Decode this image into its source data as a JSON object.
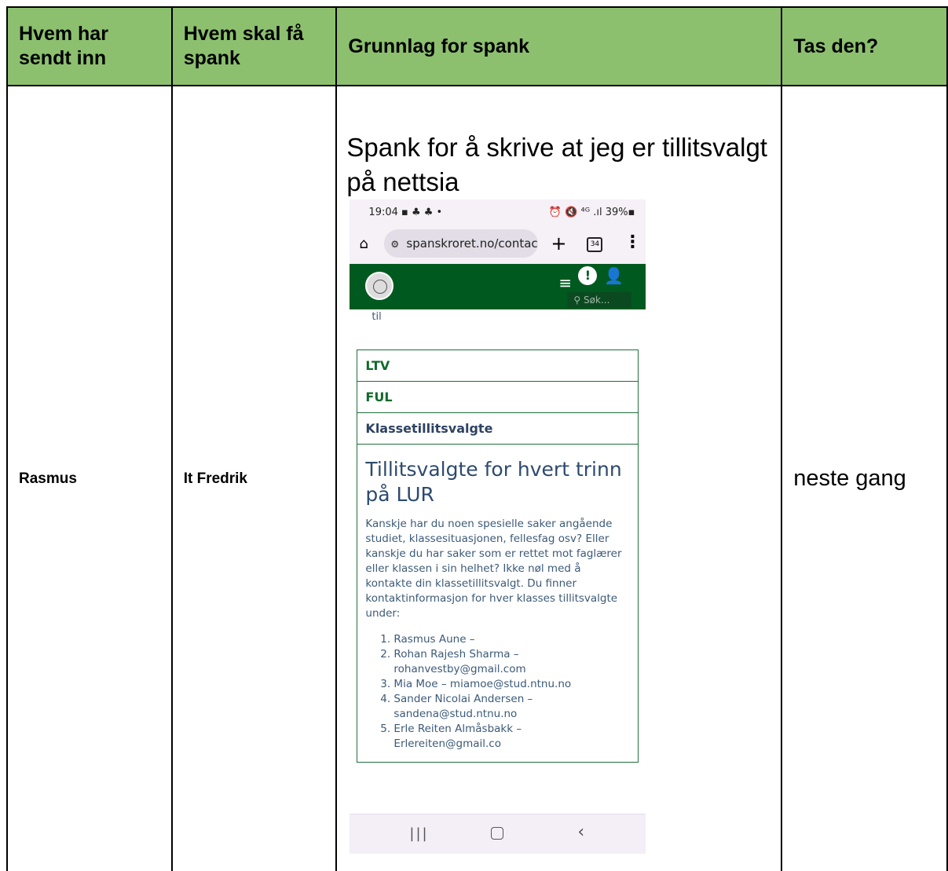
{
  "headers": {
    "col1": "Hvem har sendt inn",
    "col2": "Hvem skal få spank",
    "col3": "Grunnlag for spank",
    "col4": "Tas den?"
  },
  "row": {
    "sender": "Rasmus",
    "target": "It Fredrik",
    "reason": "Spank for å skrive at jeg er tillitsvalgt på nettsia",
    "decision": "neste gang"
  },
  "phone": {
    "status_time": "19:04 ▪ ♣ ♣ •",
    "status_right": "⏰ 🔇 ⁴ᴳ .ıl 39%▪",
    "url": "spanskroret.no/contac",
    "tab_count": "34",
    "search_placeholder": "Søk...",
    "til_text": "til",
    "menu_rows": [
      "LTV",
      "FUL",
      "Klassetillitsvalgte"
    ],
    "heading": "Tillitsvalgte for hvert trinn på LUR",
    "paragraph": "Kanskje har du noen spesielle saker angående studiet, klassesituasjonen, fellesfag osv? Eller kanskje du har saker som er rettet mot faglærer eller klassen i sin helhet? Ikke nøl med å kontakte din klassetillitsvalgt. Du finner kontaktinformasjon for hver klasses tillitsvalgte under:",
    "list": [
      "Rasmus Aune –",
      "Rohan Rajesh Sharma – rohanvestby@gmail.com",
      "Mia Moe – miamoe@stud.ntnu.no",
      "Sander Nicolai Andersen – sandena@stud.ntnu.no",
      "Erle Reiten Almåsbakk – Erlereiten@gmail.co"
    ]
  }
}
